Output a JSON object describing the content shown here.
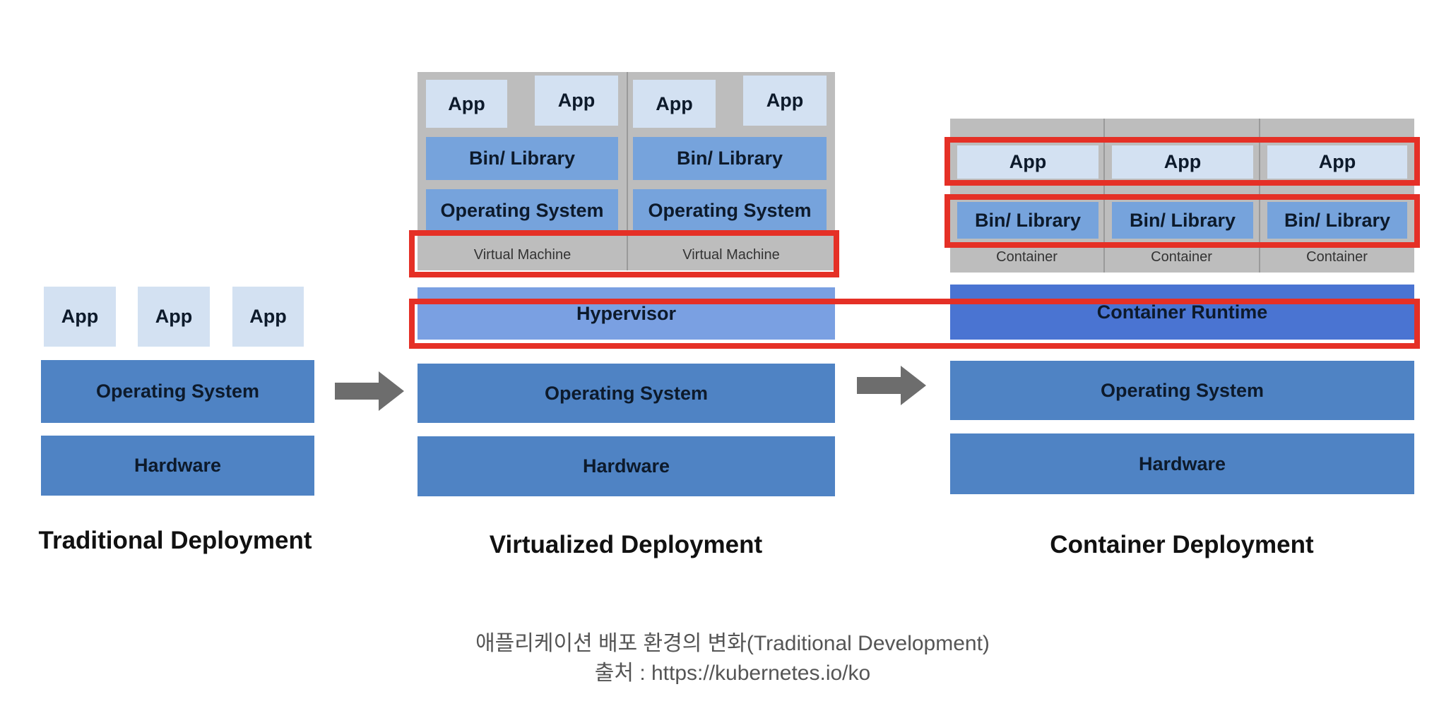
{
  "traditional": {
    "apps": [
      "App",
      "App",
      "App"
    ],
    "os": "Operating System",
    "hardware": "Hardware",
    "title": "Traditional Deployment"
  },
  "virtualized": {
    "vms": [
      {
        "apps": [
          "App",
          "App"
        ],
        "bin": "Bin/ Library",
        "os": "Operating System",
        "label": "Virtual Machine"
      },
      {
        "apps": [
          "App",
          "App"
        ],
        "bin": "Bin/ Library",
        "os": "Operating System",
        "label": "Virtual Machine"
      }
    ],
    "hypervisor": "Hypervisor",
    "os": "Operating System",
    "hardware": "Hardware",
    "title": "Virtualized Deployment"
  },
  "container": {
    "containers": [
      {
        "app": "App",
        "bin": "Bin/ Library",
        "label": "Container"
      },
      {
        "app": "App",
        "bin": "Bin/ Library",
        "label": "Container"
      },
      {
        "app": "App",
        "bin": "Bin/ Library",
        "label": "Container"
      }
    ],
    "runtime": "Container Runtime",
    "os": "Operating System",
    "hardware": "Hardware",
    "title": "Container Deployment"
  },
  "caption": {
    "line1": "애플리케이션 배포 환경의 변화(Traditional Development)",
    "line2": "출처 : https://kubernetes.io/ko"
  },
  "colors": {
    "highlight": "#e53026",
    "layer_dark": "#4f83c4",
    "layer_mid": "#76a3dc",
    "runtime": "#4a74d2",
    "app": "#d3e1f2",
    "vm_bg": "#bdbdbd",
    "arrow": "#6d6d6d"
  }
}
